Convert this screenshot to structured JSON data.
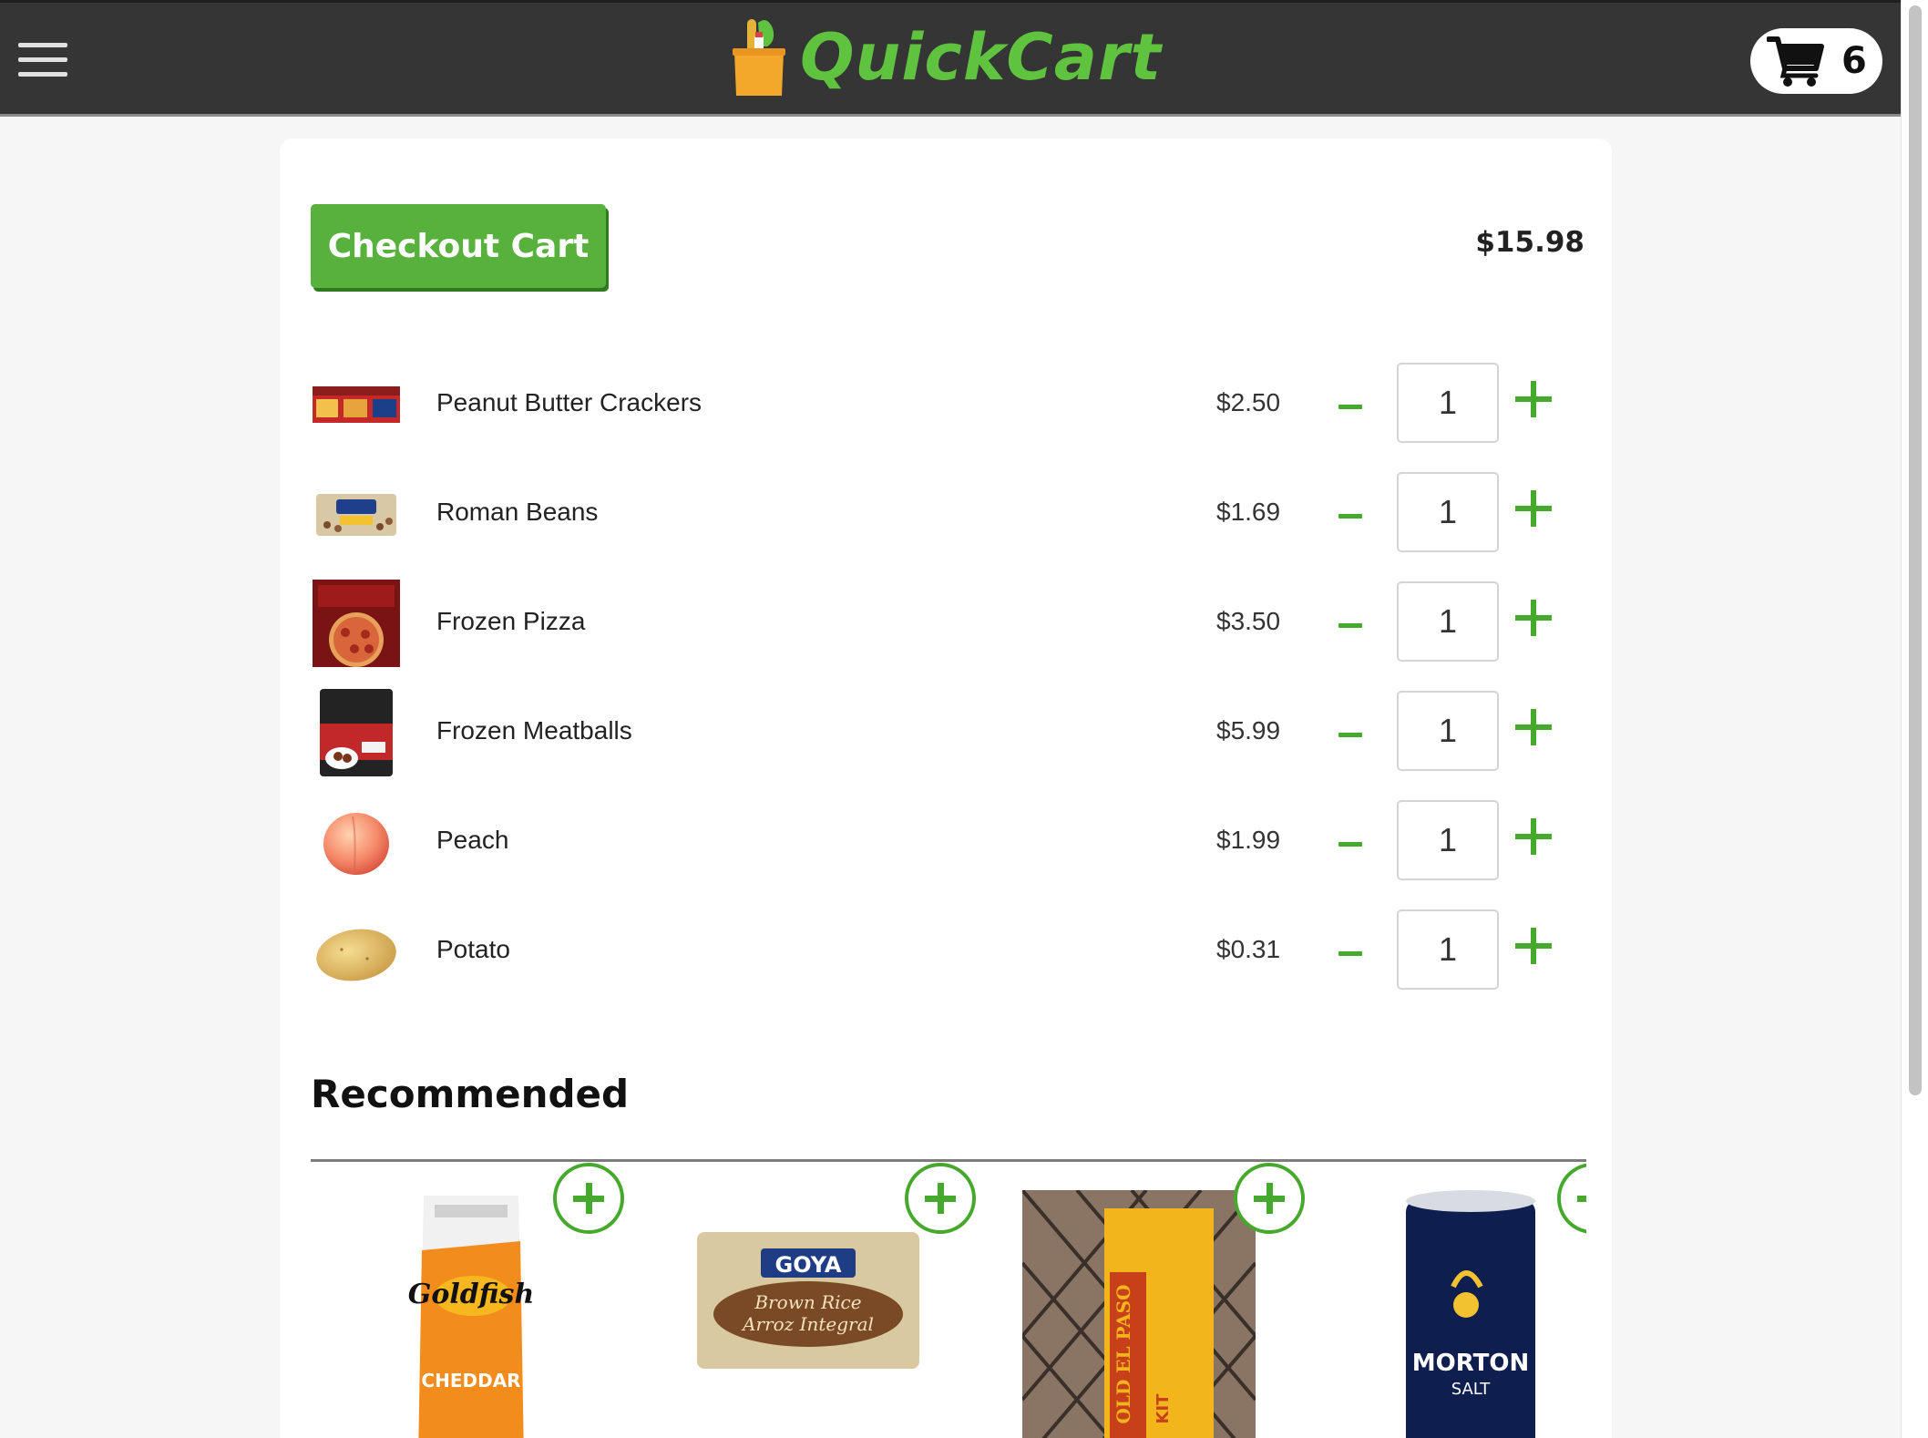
{
  "header": {
    "app_name": "QuickCart",
    "cart_count": "6"
  },
  "cart": {
    "checkout_label": "Checkout Cart",
    "total": "$15.98",
    "items": [
      {
        "name": "Peanut Butter Crackers",
        "price": "$2.50",
        "quantity": "1",
        "thumbnail_icon": "crackers-box-icon"
      },
      {
        "name": "Roman Beans",
        "price": "$1.69",
        "quantity": "1",
        "thumbnail_icon": "beans-bag-icon"
      },
      {
        "name": "Frozen Pizza",
        "price": "$3.50",
        "quantity": "1",
        "thumbnail_icon": "pizza-box-icon"
      },
      {
        "name": "Frozen Meatballs",
        "price": "$5.99",
        "quantity": "1",
        "thumbnail_icon": "meatballs-bag-icon"
      },
      {
        "name": "Peach",
        "price": "$1.99",
        "quantity": "1",
        "thumbnail_icon": "peach-icon"
      },
      {
        "name": "Potato",
        "price": "$0.31",
        "quantity": "1",
        "thumbnail_icon": "potato-icon"
      }
    ]
  },
  "recommended": {
    "title": "Recommended",
    "products": [
      {
        "brand": "Goldfish",
        "variant": "CHEDDAR",
        "icon": "goldfish-bag-icon"
      },
      {
        "brand": "GOYA",
        "variant": "Brown Rice",
        "variant2": "Arroz Integral",
        "icon": "rice-bag-icon"
      },
      {
        "brand": "OLD EL PASO",
        "variant": "KIT",
        "icon": "taco-kit-icon"
      },
      {
        "brand": "MORTON",
        "variant": "SALT",
        "icon": "salt-canister-icon"
      }
    ]
  },
  "colors": {
    "brand_green": "#58b13d",
    "header_bg": "#353535",
    "accent_green": "#47a82e"
  }
}
